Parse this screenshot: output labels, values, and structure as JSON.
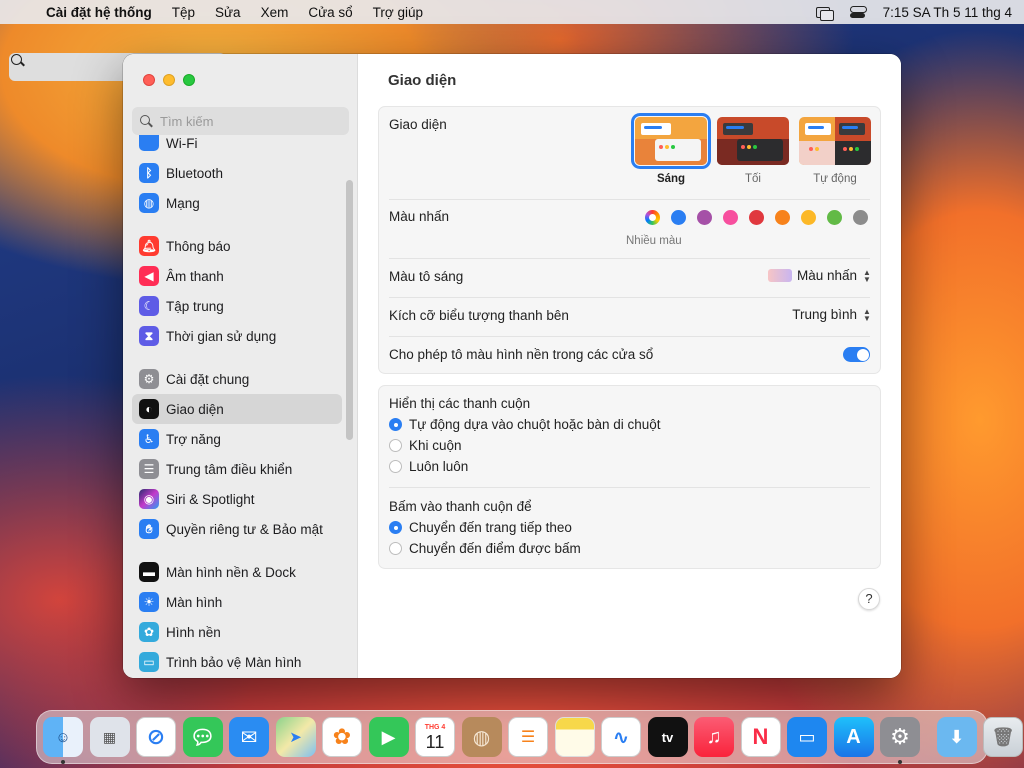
{
  "menubar": {
    "app_name": "Cài đặt hệ thống",
    "menus": [
      "Tệp",
      "Sửa",
      "Xem",
      "Cửa sổ",
      "Trợ giúp"
    ],
    "clock": "7:15 SA Th 5 11 thg 4"
  },
  "sidebar": {
    "search_placeholder": "Tìm kiếm",
    "items": [
      {
        "label": "Wi-Fi",
        "icon": "wifi-icon",
        "color": "#2a7ef2"
      },
      {
        "label": "Bluetooth",
        "icon": "bluetooth-icon",
        "color": "#2a7ef2"
      },
      {
        "label": "Mạng",
        "icon": "globe-icon",
        "color": "#2a7ef2"
      },
      {
        "label": "Thông báo",
        "icon": "bell-icon",
        "color": "#ff3b30"
      },
      {
        "label": "Âm thanh",
        "icon": "speaker-icon",
        "color": "#ff2d55"
      },
      {
        "label": "Tập trung",
        "icon": "moon-icon",
        "color": "#5e5ce6"
      },
      {
        "label": "Thời gian sử dụng",
        "icon": "hourglass-icon",
        "color": "#5e5ce6"
      },
      {
        "label": "Cài đặt chung",
        "icon": "gear-icon",
        "color": "#8e8e93"
      },
      {
        "label": "Giao diện",
        "icon": "appearance-icon",
        "color": "#111111"
      },
      {
        "label": "Trợ năng",
        "icon": "accessibility-icon",
        "color": "#2a7ef2"
      },
      {
        "label": "Trung tâm điều khiển",
        "icon": "control-center-icon",
        "color": "#8e8e93"
      },
      {
        "label": "Siri & Spotlight",
        "icon": "siri-icon",
        "color": "#7a3bd6"
      },
      {
        "label": "Quyền riêng tư & Bảo mật",
        "icon": "hand-icon",
        "color": "#2a7ef2"
      },
      {
        "label": "Màn hình nền & Dock",
        "icon": "dock-icon",
        "color": "#111111"
      },
      {
        "label": "Màn hình",
        "icon": "sun-icon",
        "color": "#2a7ef2"
      },
      {
        "label": "Hình nền",
        "icon": "flower-icon",
        "color": "#34aadc"
      },
      {
        "label": "Trình bảo vệ Màn hình",
        "icon": "screensaver-icon",
        "color": "#34aadc"
      }
    ],
    "selected": "Giao diện"
  },
  "content": {
    "title": "Giao diện",
    "appearance": {
      "label": "Giao diện",
      "options": [
        "Sáng",
        "Tối",
        "Tự động"
      ],
      "selected": "Sáng"
    },
    "accent": {
      "label": "Màu nhấn",
      "caption": "Nhiều màu",
      "colors": [
        "multicolor",
        "#2a7ef2",
        "#a550a7",
        "#f74f9e",
        "#e0383e",
        "#f7821b",
        "#fcb827",
        "#62ba46",
        "#8c8c8c"
      ]
    },
    "highlight": {
      "label": "Màu tô sáng",
      "value": "Màu nhấn"
    },
    "sidebar_icon_size": {
      "label": "Kích cỡ biểu tượng thanh bên",
      "value": "Trung bình"
    },
    "wallpaper_tinting": {
      "label": "Cho phép tô màu hình nền trong các cửa sổ",
      "enabled": true
    },
    "show_scrollbars": {
      "label": "Hiển thị các thanh cuộn",
      "options": [
        "Tự động dựa vào chuột hoặc bàn di chuột",
        "Khi cuộn",
        "Luôn luôn"
      ],
      "selected": 0
    },
    "click_scrollbar": {
      "label": "Bấm vào thanh cuộn để",
      "options": [
        "Chuyển đến trang tiếp theo",
        "Chuyển đến điểm được bấm"
      ],
      "selected": 0
    },
    "help": "?"
  },
  "dock": {
    "apps": [
      "Finder",
      "Launchpad",
      "Safari",
      "Messages",
      "Mail",
      "Maps",
      "Photos",
      "FaceTime",
      "Calendar",
      "Contacts",
      "Reminders",
      "Notes",
      "Freeform",
      "TV",
      "Music",
      "News",
      "Keynote",
      "App Store",
      "System Settings"
    ],
    "calendar_month": "THG 4",
    "calendar_day": "11",
    "tv_label": "tv"
  }
}
